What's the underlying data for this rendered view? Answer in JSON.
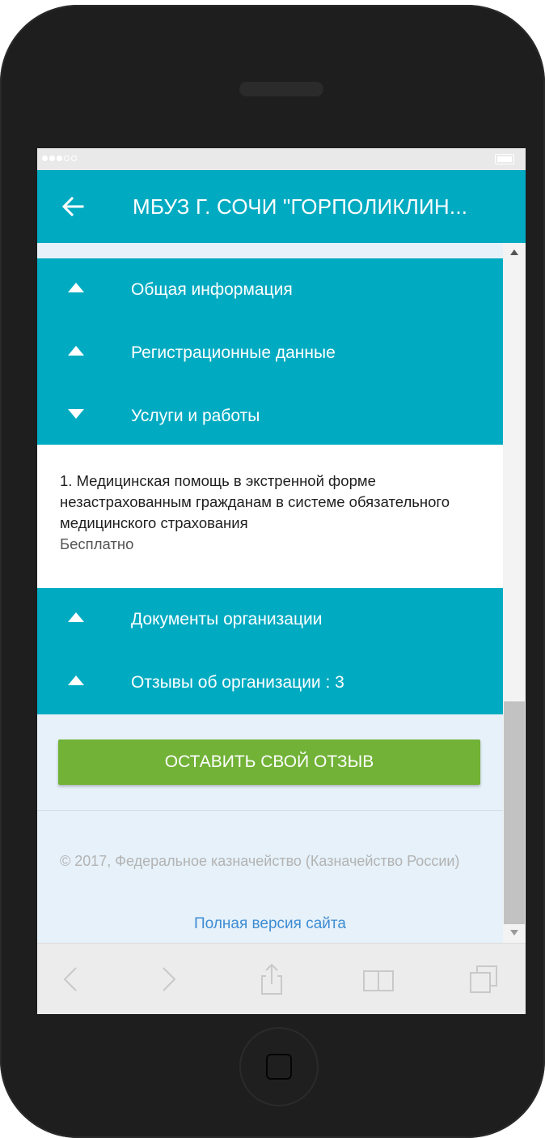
{
  "header": {
    "title": "МБУЗ Г. СОЧИ \"ГОРПОЛИКЛИН..."
  },
  "accordion": {
    "items": [
      {
        "label": "Общая информация",
        "expanded": false
      },
      {
        "label": "Регистрационные данные",
        "expanded": false
      },
      {
        "label": "Услуги и работы",
        "expanded": true
      },
      {
        "label": "Документы организации",
        "expanded": false
      },
      {
        "label": "Отзывы об организации : 3",
        "expanded": false
      }
    ]
  },
  "services": {
    "item_text": "1. Медицинская помощь в экстренной форме незастрахованным гражданам в системе обязательного медицинского страхования",
    "price": "Бесплатно"
  },
  "actions": {
    "review_button": "ОСТАВИТЬ СВОЙ ОТЗЫВ"
  },
  "footer": {
    "copyright": "© 2017, Федеральное казначейство (Казначейство России)",
    "full_version_link": "Полная версия сайта"
  },
  "colors": {
    "primary": "#00abc2",
    "button": "#71b237",
    "link": "#3f8cd3",
    "background": "#e6f1f9"
  },
  "icons": {
    "back": "arrow-left-icon",
    "collapsed": "triangle-up-icon",
    "expanded": "triangle-down-icon",
    "browser_back": "chevron-left-icon",
    "browser_forward": "chevron-right-icon",
    "share": "share-icon",
    "bookmarks": "book-icon",
    "tabs": "tabs-icon"
  }
}
